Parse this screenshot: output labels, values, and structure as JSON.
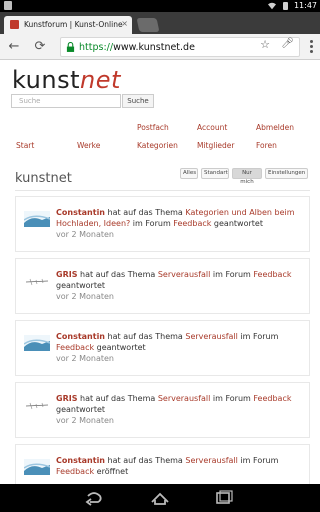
{
  "status_bar": {
    "time": "11:47"
  },
  "browser": {
    "tab_title": "Kunstforum | Kunst-Online",
    "tab_close": "×",
    "url_scheme": "https://",
    "url_host": "www.kunstnet.de",
    "back_icon": "←",
    "reload_icon": "⟳"
  },
  "site": {
    "logo_main": "kunst",
    "logo_accent": "net",
    "search_placeholder": "Suche",
    "search_button": "Suche"
  },
  "nav": [
    {
      "label": "Start"
    },
    {
      "label": "Werke"
    },
    {
      "label": "Postfach"
    },
    {
      "label": "Kategorien"
    },
    {
      "label": "Account"
    },
    {
      "label": "Mitglieder"
    },
    {
      "label": "Abmelden"
    },
    {
      "label": "Foren"
    }
  ],
  "filters": [
    "Alles",
    "Standart",
    "Nur mich",
    "Einstellungen"
  ],
  "active_filter": "Nur mich",
  "section_title": "kunstnet",
  "feed": [
    {
      "user": "Constantin",
      "pre": " hat auf das Thema ",
      "topic": "Kategorien und Alben beim Hochladen, Ideen?",
      "mid": " im Forum ",
      "forum": "Feedback",
      "action": " geantwortet",
      "time": "vor 2 Monaten"
    },
    {
      "user": "GRIS",
      "pre": " hat auf das Thema ",
      "topic": "Serverausfall",
      "mid": " im Forum ",
      "forum": "Feedback",
      "action": " geantwortet",
      "time": "vor 2 Monaten"
    },
    {
      "user": "Constantin",
      "pre": " hat auf das Thema ",
      "topic": "Serverausfall",
      "mid": " im Forum ",
      "forum": "Feedback",
      "action": " geantwortet",
      "time": "vor 2 Monaten"
    },
    {
      "user": "GRIS",
      "pre": " hat auf das Thema ",
      "topic": "Serverausfall",
      "mid": " im Forum ",
      "forum": "Feedback",
      "action": " geantwortet",
      "time": "vor 2 Monaten"
    },
    {
      "user": "Constantin",
      "pre": " hat auf das Thema ",
      "topic": "Serverausfall",
      "mid": " im Forum ",
      "forum": "Feedback",
      "action": " eröffnet",
      "time": ""
    }
  ],
  "colors": {
    "accent": "#a83a2a",
    "logo_accent": "#c0392b",
    "secure": "#0a8a2a"
  }
}
